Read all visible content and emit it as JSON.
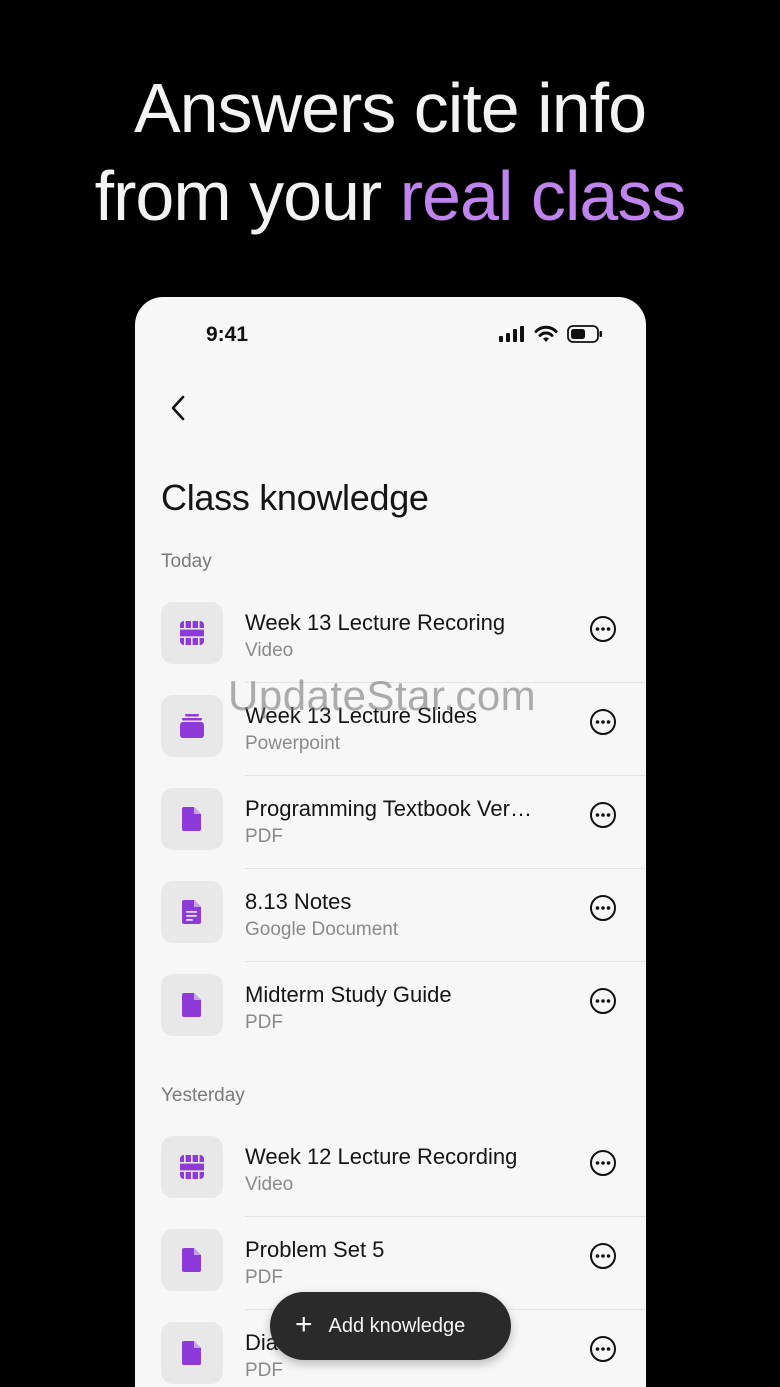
{
  "headline": {
    "line1": "Answers cite info",
    "line2_plain": "from your ",
    "line2_accent": "real class"
  },
  "status": {
    "time": "9:41"
  },
  "page_title": "Class knowledge",
  "sections": [
    {
      "label": "Today",
      "items": [
        {
          "name": "Week 13 Lecture Recoring",
          "kind": "Video",
          "icon": "video-icon"
        },
        {
          "name": "Week 13 Lecture Slides",
          "kind": "Powerpoint",
          "icon": "slides-icon"
        },
        {
          "name": "Programming Textbook Ver…",
          "kind": "PDF",
          "icon": "pdf-icon"
        },
        {
          "name": "8.13 Notes",
          "kind": "Google Document",
          "icon": "doc-icon"
        },
        {
          "name": "Midterm Study Guide",
          "kind": "PDF",
          "icon": "pdf-icon"
        }
      ]
    },
    {
      "label": "Yesterday",
      "items": [
        {
          "name": "Week 12 Lecture Recording",
          "kind": "Video",
          "icon": "video-icon"
        },
        {
          "name": "Problem Set 5",
          "kind": "PDF",
          "icon": "pdf-icon"
        },
        {
          "name": "Dia",
          "kind": "PDF",
          "icon": "pdf-icon"
        }
      ]
    }
  ],
  "fab": {
    "label": "Add knowledge"
  },
  "watermark": "UpdateStar.com",
  "colors": {
    "accent": "#bf84ee",
    "icon_purple": "#8e3ad9",
    "background": "#000000",
    "panel": "#f7f7f7"
  }
}
